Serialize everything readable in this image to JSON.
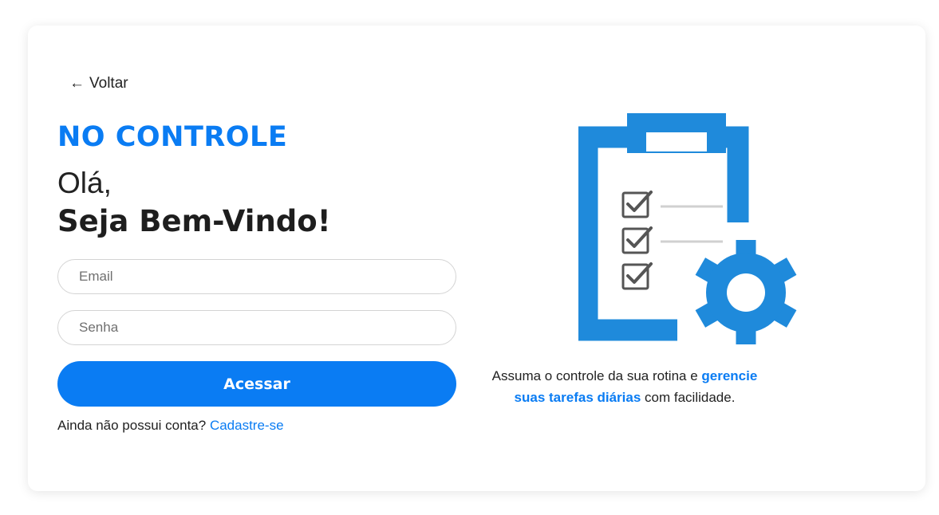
{
  "nav": {
    "back_arrow": "←",
    "back_label": "Voltar"
  },
  "brand": {
    "name": "NO CONTROLE"
  },
  "greeting": {
    "line1": "Olá,",
    "line2": "Seja Bem-Vindo!"
  },
  "form": {
    "email_placeholder": "Email",
    "email_value": "",
    "password_placeholder": "Senha",
    "password_value": "",
    "submit_label": "Acessar"
  },
  "signup": {
    "prompt": "Ainda não possui conta?",
    "link_label": "Cadastre-se"
  },
  "tagline": {
    "part1": "Assuma o controle da sua rotina e ",
    "highlight": "gerencie suas tarefas diárias",
    "part2": " com facilidade."
  },
  "illustration": {
    "icon": "clipboard-checklist-gear-icon"
  },
  "colors": {
    "accent": "#0A7CF3",
    "illustration_blue": "#1F8ADB",
    "text": "#222222"
  }
}
